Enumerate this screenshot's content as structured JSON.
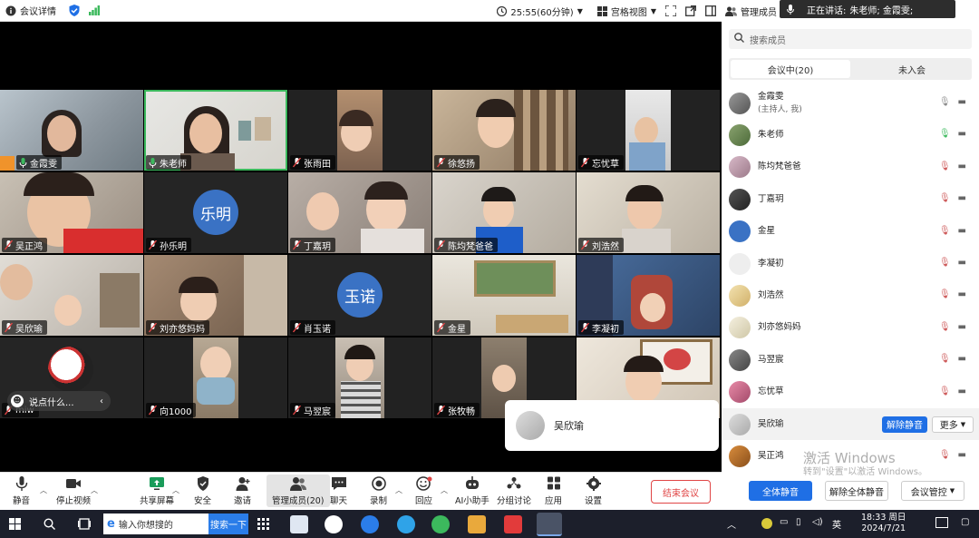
{
  "topbar": {
    "meeting_details": "会议详情",
    "timer": "25:55(60分钟)",
    "view_mode": "宫格视图",
    "manage_members": "管理成员"
  },
  "speaking": {
    "label": "正在讲话:",
    "names": "朱老师; 金霞雯;"
  },
  "tiles": [
    {
      "name": "金霞雯"
    },
    {
      "name": "朱老师"
    },
    {
      "name": "张雨田"
    },
    {
      "name": "徐悠扬"
    },
    {
      "name": "忘忧草"
    },
    {
      "name": "吴正鸿"
    },
    {
      "name": "孙乐明",
      "avatar_text": "乐明"
    },
    {
      "name": "丁嘉玥"
    },
    {
      "name": "陈均梵爸爸"
    },
    {
      "name": "刘浩然"
    },
    {
      "name": "吴欣瑜"
    },
    {
      "name": "刘亦悠妈妈"
    },
    {
      "name": "肖玉诺",
      "avatar_text": "玉诺"
    },
    {
      "name": "金星"
    },
    {
      "name": "李凝初"
    },
    {
      "name": "miw"
    },
    {
      "name": "向1000"
    },
    {
      "name": "马翌宸"
    },
    {
      "name": "张牧畅"
    },
    {
      "name": ""
    }
  ],
  "chat_bubble": "说点什么...",
  "popup_name": "吴欣瑜",
  "panel": {
    "search_placeholder": "搜索成员",
    "tab_in": "会议中(20)",
    "tab_out": "未入会",
    "members": [
      {
        "name": "金霞雯",
        "note": "(主持人, 我)"
      },
      {
        "name": "朱老师"
      },
      {
        "name": "陈均梵爸爸"
      },
      {
        "name": "丁嘉玥"
      },
      {
        "name": "金星"
      },
      {
        "name": "李凝初"
      },
      {
        "name": "刘浩然"
      },
      {
        "name": "刘亦悠妈妈"
      },
      {
        "name": "马翌宸"
      },
      {
        "name": "忘忧草"
      },
      {
        "name": "吴欣瑜"
      },
      {
        "name": "吴正鸿"
      }
    ],
    "unmute_label": "解除静音",
    "more_label": "更多",
    "mute_all": "全体静音",
    "unmute_all": "解除全体静音",
    "meeting_control": "会议管控"
  },
  "toolbar": {
    "mute": "静音",
    "stop_video": "停止视频",
    "share": "共享屏幕",
    "security": "安全",
    "invite": "邀请",
    "members": "管理成员(20)",
    "chat": "聊天",
    "record": "录制",
    "react": "回应",
    "ai": "AI小助手",
    "breakout": "分组讨论",
    "apps": "应用",
    "settings": "设置",
    "end": "结束会议"
  },
  "watermark": {
    "line1": "激活 Windows",
    "line2": "转到\"设置\"以激活 Windows。"
  },
  "taskbar": {
    "search_placeholder": "输入你想搜的",
    "search_button": "搜索一下",
    "ime": "英",
    "time": "18:33 周日",
    "date": "2024/7/21"
  },
  "colors": {
    "accent": "#1f6fe5",
    "end_red": "#e04545",
    "speaking_green": "#3cb95d",
    "avatar_blue": "#3a72c4"
  }
}
